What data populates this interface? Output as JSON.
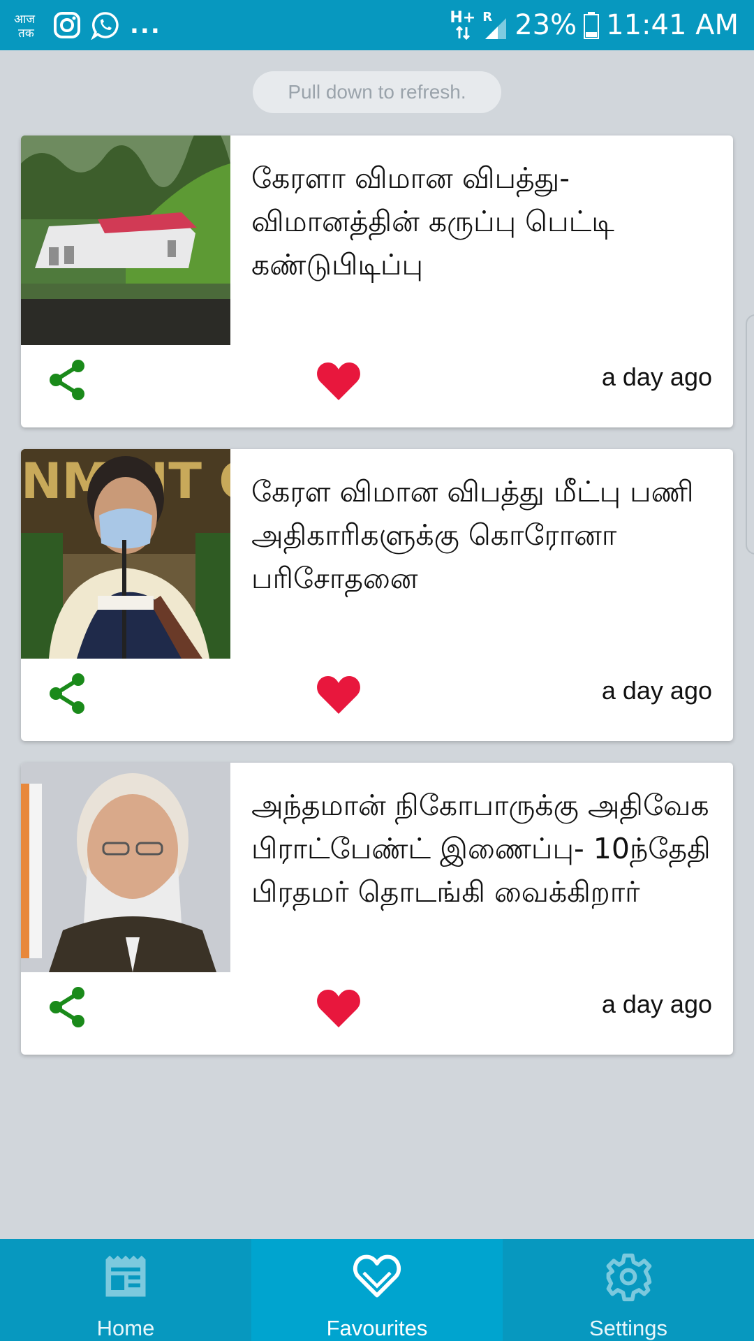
{
  "status_bar": {
    "app_badge": "आज\nतक",
    "more": "...",
    "network_type": "H+",
    "roaming": "R",
    "battery": "23%",
    "time": "11:41 AM"
  },
  "refresh_hint": "Pull down to refresh.",
  "articles": [
    {
      "title": "கேரளா விமான விபத்து- விமானத்தின் கருப்பு பெட்டி கண்டுபிடிப்பு",
      "time": "a day ago"
    },
    {
      "title": "கேரள விமான விபத்து மீட்பு பணி அதிகாரிகளுக்கு கொரோனா பரிசோதனை",
      "time": "a day ago"
    },
    {
      "title": "அந்தமான் நிகோபாருக்கு அதிவேக பிராட்பேண்ட் இணைப்பு- 10ந்தேதி பிரதமர் தொடங்கி வைக்கிறார்",
      "time": "a day ago"
    }
  ],
  "nav": {
    "home": "Home",
    "favourites": "Favourites",
    "settings": "Settings",
    "active": "favourites"
  },
  "colors": {
    "primary": "#0798bf",
    "active_tab": "#00a4cf",
    "share_icon": "#1a8a1a",
    "heart_icon": "#e8173d",
    "background": "#d1d6db"
  }
}
